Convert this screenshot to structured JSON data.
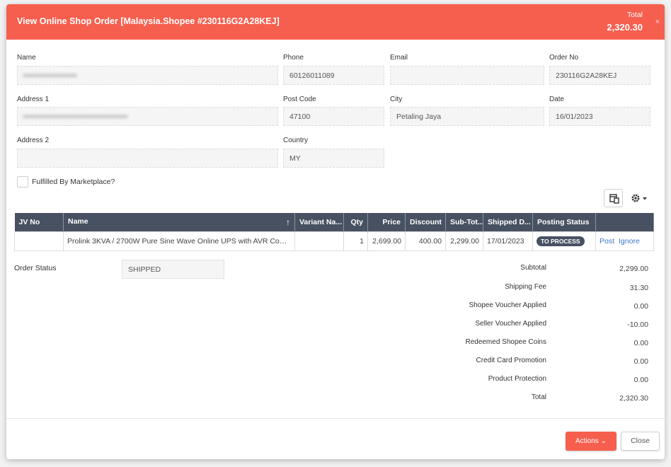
{
  "header": {
    "title": "View Online Shop Order [Malaysia.Shopee #230116G2A28KEJ]",
    "total_label": "Total",
    "total_value": "2,320.30",
    "close_glyph": "×"
  },
  "form": {
    "name": {
      "label": "Name",
      "value": "▪▪▪▪▪▪▪▪▪▪▪▪▪▪▪▪▪▪"
    },
    "phone": {
      "label": "Phone",
      "value": "60126011089"
    },
    "email": {
      "label": "Email",
      "value": ""
    },
    "order_no": {
      "label": "Order No",
      "value": "230116G2A28KEJ"
    },
    "address1": {
      "label": "Address 1",
      "value": "▪▪▪▪▪▪▪▪▪▪▪▪▪▪▪▪▪▪▪▪▪▪▪▪▪▪▪▪▪▪▪▪▪▪▪"
    },
    "post_code": {
      "label": "Post Code",
      "value": "47100"
    },
    "city": {
      "label": "City",
      "value": "Petaling Jaya"
    },
    "date": {
      "label": "Date",
      "value": "16/01/2023"
    },
    "address2": {
      "label": "Address 2",
      "value": ""
    },
    "country": {
      "label": "Country",
      "value": "MY"
    },
    "fulfilled_label": "Fulfilled By Marketplace?"
  },
  "toolbar": {
    "layout_icon": "layout-icon",
    "gear_icon": "gear-icon"
  },
  "table": {
    "headers": [
      "JV No",
      "Name",
      "Variant Na...",
      "Qty",
      "Price",
      "Discount",
      "Sub-Tot...",
      "Shipped D...",
      "Posting Status",
      ""
    ],
    "sort_glyph": "↑",
    "row": {
      "jv_no": "",
      "name": "Prolink 3KVA / 2700W Pure Sine Wave Online UPS with AVR Com...",
      "variant": "",
      "qty": "1",
      "price": "2,699.00",
      "discount": "400.00",
      "subtotal": "2,299.00",
      "shipped_date": "17/01/2023",
      "posting_status": "TO PROCESS",
      "post_link": "Post",
      "ignore_link": "Ignore"
    }
  },
  "order_status": {
    "label": "Order Status",
    "value": "SHIPPED"
  },
  "summary": [
    {
      "label": "Subtotal",
      "value": "2,299.00"
    },
    {
      "label": "Shipping Fee",
      "value": "31.30"
    },
    {
      "label": "Shopee Voucher Applied",
      "value": "0.00"
    },
    {
      "label": "Seller Voucher Applied",
      "value": "-10.00"
    },
    {
      "label": "Redeemed Shopee Coins",
      "value": "0.00"
    },
    {
      "label": "Credit Card Promotion",
      "value": "0.00"
    },
    {
      "label": "Product Protection",
      "value": "0.00"
    },
    {
      "label": "Total",
      "value": "2,320.30"
    }
  ],
  "footer": {
    "actions_label": "Actions",
    "close_label": "Close"
  },
  "colors": {
    "header": "#f65e4e",
    "table_header": "#475162",
    "link": "#3b78c9"
  }
}
